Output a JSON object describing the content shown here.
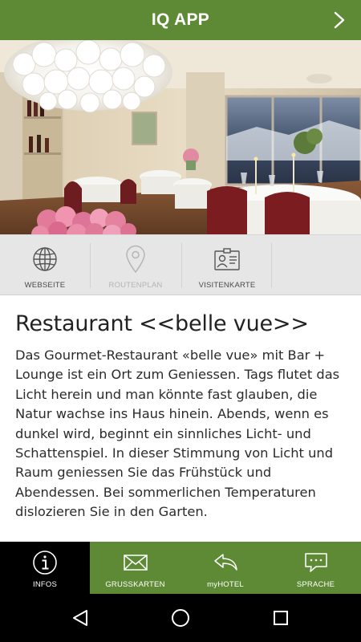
{
  "header": {
    "title": "IQ APP",
    "next_icon": "chevron-right-icon"
  },
  "hero": {
    "alt": "Restaurant dining room"
  },
  "actions": [
    {
      "label": "WEBSEITE",
      "icon": "globe-icon",
      "enabled": true
    },
    {
      "label": "ROUTENPLAN",
      "icon": "map-pin-icon",
      "enabled": false
    },
    {
      "label": "VISITENKARTE",
      "icon": "contact-card-icon",
      "enabled": true
    }
  ],
  "content": {
    "title": "Restaurant <<belle vue>>",
    "body": "Das Gourmet-Restaurant «belle vue» mit Bar + Lounge ist ein Ort zum Geniessen. Tags flutet das Licht herein und man könnte fast glauben, die Natur wachse ins Haus hinein. Abends, wenn es dunkel wird, beginnt ein sinnliches Licht- und Schattenspiel. In dieser Stimmung von Licht und Raum geniessen Sie das Frühstück und Abendessen. Bei sommerlichen Temperaturen dislozieren Sie in den Garten."
  },
  "tabs": [
    {
      "label": "INFOS",
      "icon": "info-icon",
      "active": true
    },
    {
      "label": "GRUSSKARTEN",
      "icon": "envelope-icon",
      "active": false
    },
    {
      "label": "myHOTEL",
      "icon": "reply-arrow-icon",
      "active": false
    },
    {
      "label": "SPRACHE",
      "icon": "speech-bubble-icon",
      "active": false
    }
  ],
  "colors": {
    "brand_green": "#5e8a35",
    "action_bar": "#e6e6e6",
    "active_tab": "#000000"
  }
}
